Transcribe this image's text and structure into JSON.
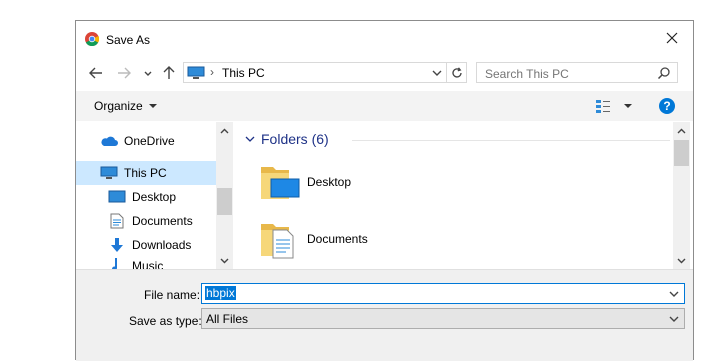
{
  "title": "Save As",
  "address": {
    "crumb": "This PC"
  },
  "search": {
    "placeholder": "Search This PC"
  },
  "toolbar": {
    "organize": "Organize"
  },
  "nav": {
    "items": [
      {
        "label": "OneDrive",
        "icon": "cloud-icon"
      },
      {
        "label": "This PC",
        "icon": "computer-icon"
      },
      {
        "label": "Desktop",
        "icon": "desktop-icon"
      },
      {
        "label": "Documents",
        "icon": "documents-icon"
      },
      {
        "label": "Downloads",
        "icon": "download-icon"
      },
      {
        "label": "Music",
        "icon": "music-icon"
      }
    ]
  },
  "content": {
    "group_header": "Folders (6)",
    "folders": [
      {
        "label": "Desktop",
        "icon": "desktop-folder-icon"
      },
      {
        "label": "Documents",
        "icon": "documents-folder-icon"
      }
    ]
  },
  "form": {
    "filename_label": "File name:",
    "filename_value": "hbpix",
    "type_label": "Save as type:",
    "type_value": "All Files"
  },
  "colors": {
    "accent": "#0078d7",
    "folder_header": "#1e3287",
    "selection": "#cce8ff"
  }
}
